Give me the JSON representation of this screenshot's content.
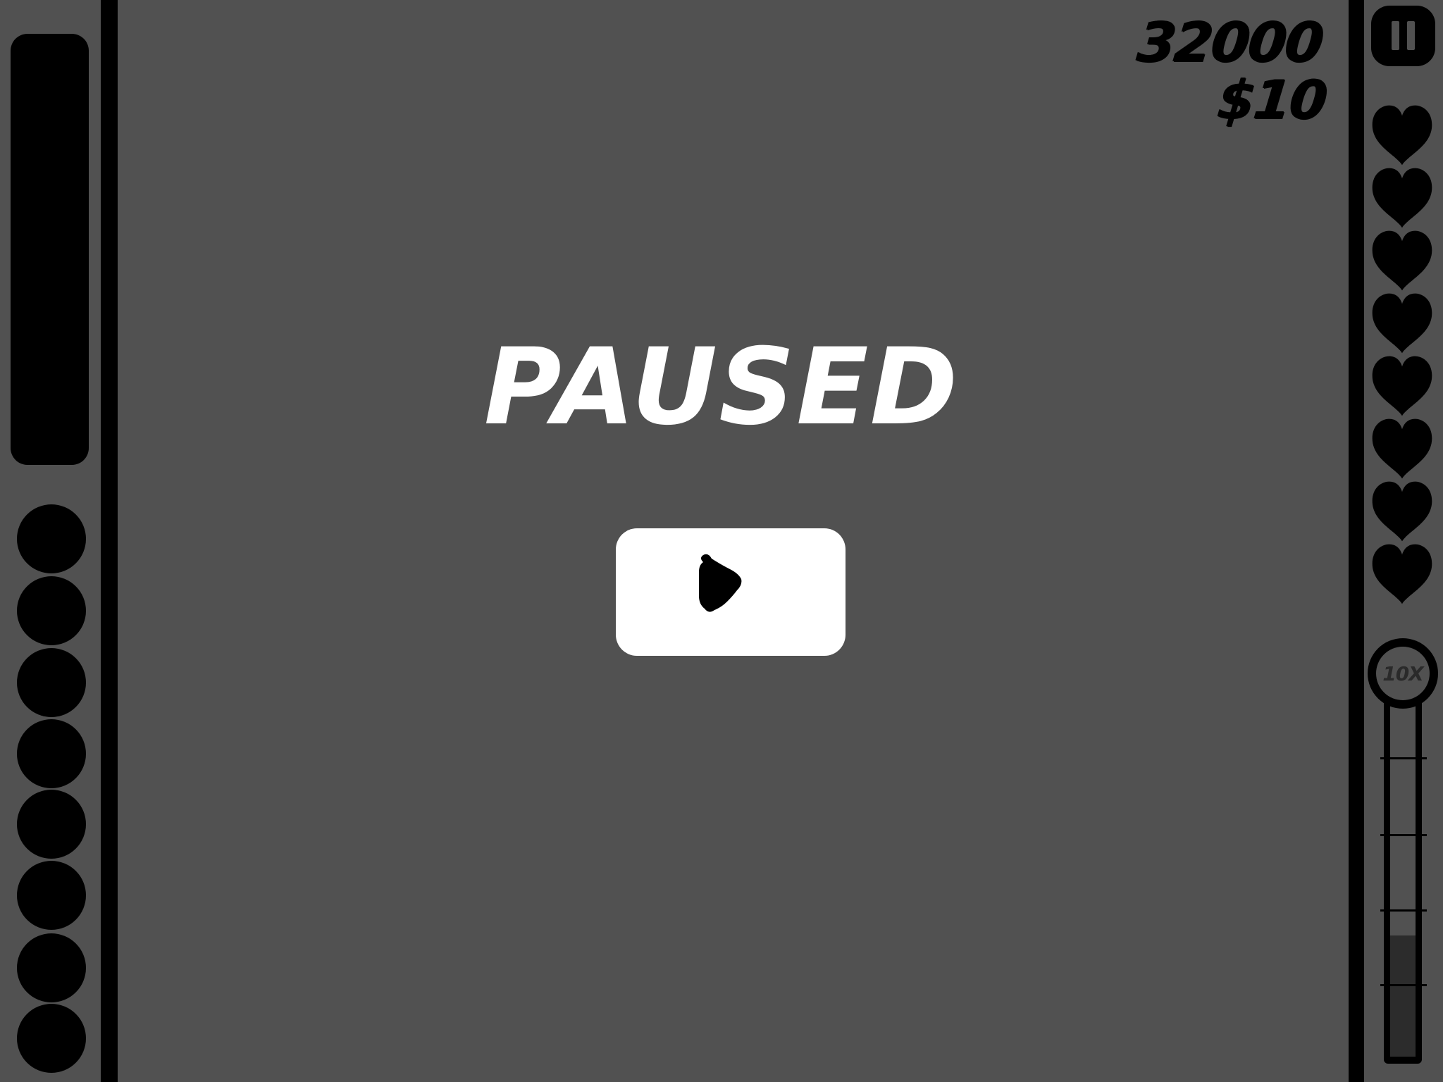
{
  "hud": {
    "score": "32000",
    "money": "$10",
    "lives": 8,
    "multiplier_label": "10X",
    "multiplier_fill": 0.33
  },
  "pause_menu": {
    "title": "PAUSED",
    "resume_icon": "play-icon"
  },
  "controls": {
    "pause_icon": "pause-icon"
  },
  "left_panel": {
    "slots": 8
  },
  "colors": {
    "background": "#515151",
    "foreground": "#000000",
    "text_light": "#ffffff"
  }
}
